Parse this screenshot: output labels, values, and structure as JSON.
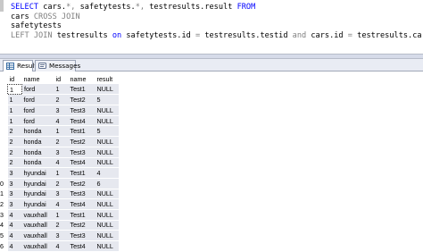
{
  "editor": {
    "lines": [
      [
        {
          "t": "SELECT",
          "c": "kw"
        },
        {
          "t": " cars.",
          "c": ""
        },
        {
          "t": "*,",
          "c": "gr"
        },
        {
          "t": " safetytests.",
          "c": ""
        },
        {
          "t": "*,",
          "c": "gr"
        },
        {
          "t": " testresults.result ",
          "c": ""
        },
        {
          "t": "FROM",
          "c": "kw"
        }
      ],
      [
        {
          "t": "cars ",
          "c": ""
        },
        {
          "t": "CROSS JOIN",
          "c": "gr"
        }
      ],
      [
        {
          "t": "safetytests",
          "c": ""
        }
      ],
      [
        {
          "t": "LEFT JOIN",
          "c": "gr"
        },
        {
          "t": " testresults ",
          "c": ""
        },
        {
          "t": "on",
          "c": "kw"
        },
        {
          "t": " safetytests.id ",
          "c": ""
        },
        {
          "t": "=",
          "c": "gr"
        },
        {
          "t": " testresults.testid ",
          "c": ""
        },
        {
          "t": "and",
          "c": "gr"
        },
        {
          "t": " cars.id ",
          "c": ""
        },
        {
          "t": "=",
          "c": "gr"
        },
        {
          "t": " testresults.carid",
          "c": ""
        }
      ]
    ]
  },
  "tabs": {
    "results_label": "Results",
    "messages_label": "Messages"
  },
  "grid": {
    "columns": [
      "id",
      "name",
      "id",
      "name",
      "result"
    ],
    "rows": [
      {
        "rn": "",
        "cells": [
          "1",
          "ford",
          "1",
          "Test1",
          "NULL"
        ]
      },
      {
        "rn": "",
        "cells": [
          "1",
          "ford",
          "2",
          "Test2",
          "5"
        ]
      },
      {
        "rn": "",
        "cells": [
          "1",
          "ford",
          "3",
          "Test3",
          "NULL"
        ]
      },
      {
        "rn": "",
        "cells": [
          "1",
          "ford",
          "4",
          "Test4",
          "NULL"
        ]
      },
      {
        "rn": "",
        "cells": [
          "2",
          "honda",
          "1",
          "Test1",
          "5"
        ]
      },
      {
        "rn": "",
        "cells": [
          "2",
          "honda",
          "2",
          "Test2",
          "NULL"
        ]
      },
      {
        "rn": "",
        "cells": [
          "2",
          "honda",
          "3",
          "Test3",
          "NULL"
        ]
      },
      {
        "rn": "",
        "cells": [
          "2",
          "honda",
          "4",
          "Test4",
          "NULL"
        ]
      },
      {
        "rn": "",
        "cells": [
          "3",
          "hyundai",
          "1",
          "Test1",
          "4"
        ]
      },
      {
        "rn": "0",
        "cells": [
          "3",
          "hyundai",
          "2",
          "Test2",
          "6"
        ]
      },
      {
        "rn": "1",
        "cells": [
          "3",
          "hyundai",
          "3",
          "Test3",
          "NULL"
        ]
      },
      {
        "rn": "2",
        "cells": [
          "3",
          "hyundai",
          "4",
          "Test4",
          "NULL"
        ]
      },
      {
        "rn": "3",
        "cells": [
          "4",
          "vauxhall",
          "1",
          "Test1",
          "NULL"
        ]
      },
      {
        "rn": "4",
        "cells": [
          "4",
          "vauxhall",
          "2",
          "Test2",
          "NULL"
        ]
      },
      {
        "rn": "5",
        "cells": [
          "4",
          "vauxhall",
          "3",
          "Test3",
          "NULL"
        ]
      },
      {
        "rn": "6",
        "cells": [
          "4",
          "vauxhall",
          "4",
          "Test4",
          "NULL"
        ]
      }
    ],
    "selected_row": 0,
    "selected_col": 0
  }
}
